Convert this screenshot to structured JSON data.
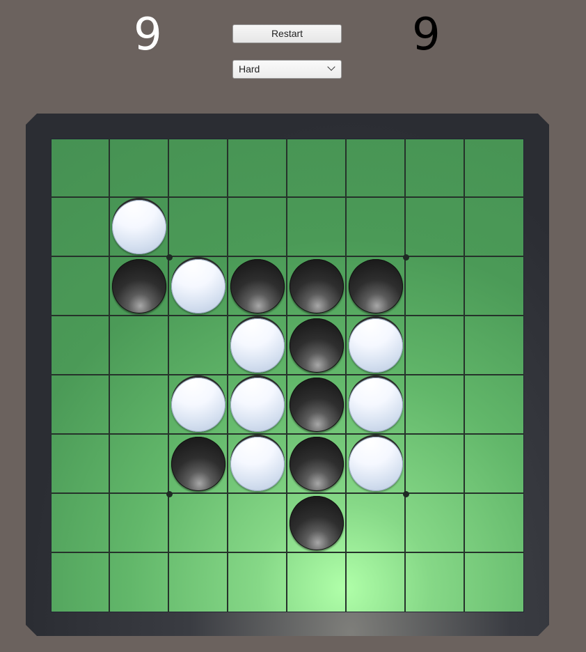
{
  "scores": {
    "white": "9",
    "black": "9"
  },
  "controls": {
    "restart_label": "Restart",
    "difficulty": {
      "selected": "Hard"
    }
  },
  "board": {
    "size": 8,
    "colors": {
      "felt": "#469153",
      "highlight": "#b0ffa9",
      "grid": "#25322a",
      "frame": "#2b2d33",
      "background": "#6b625e"
    },
    "discs": [
      {
        "row": 1,
        "col": 1,
        "color": "white"
      },
      {
        "row": 2,
        "col": 1,
        "color": "black"
      },
      {
        "row": 2,
        "col": 2,
        "color": "white"
      },
      {
        "row": 2,
        "col": 3,
        "color": "black"
      },
      {
        "row": 2,
        "col": 4,
        "color": "black"
      },
      {
        "row": 2,
        "col": 5,
        "color": "black"
      },
      {
        "row": 3,
        "col": 3,
        "color": "white"
      },
      {
        "row": 3,
        "col": 4,
        "color": "black"
      },
      {
        "row": 3,
        "col": 5,
        "color": "white"
      },
      {
        "row": 4,
        "col": 2,
        "color": "white"
      },
      {
        "row": 4,
        "col": 3,
        "color": "white"
      },
      {
        "row": 4,
        "col": 4,
        "color": "black"
      },
      {
        "row": 4,
        "col": 5,
        "color": "white"
      },
      {
        "row": 5,
        "col": 2,
        "color": "black"
      },
      {
        "row": 5,
        "col": 3,
        "color": "white"
      },
      {
        "row": 5,
        "col": 4,
        "color": "black"
      },
      {
        "row": 5,
        "col": 5,
        "color": "white"
      },
      {
        "row": 6,
        "col": 4,
        "color": "black"
      }
    ]
  }
}
